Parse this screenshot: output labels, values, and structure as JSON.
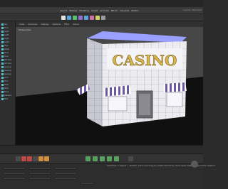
{
  "menubar": {
    "items": [
      "Layout",
      "Startup",
      "Modeling",
      "Sculpt",
      "Animate",
      "BP-UV",
      "Visualize",
      "Motion"
    ]
  },
  "header": {
    "right_info": "Layout: Standard"
  },
  "viewport": {
    "menus": [
      "View",
      "Cameras",
      "Display",
      "Options",
      "Filter",
      "Panel"
    ],
    "label": "Perspective",
    "sign_text": "CASINO"
  },
  "objects": {
    "items": [
      "Sky",
      "Floor",
      "Light",
      "Light",
      "Light",
      "Light",
      "Sign",
      "Walls",
      "Roof",
      "Door",
      "Window",
      "Window",
      "Awning",
      "Awning",
      "Awning",
      "Trim",
      "Trim",
      "Pillar",
      "Pillar",
      "Base",
      "Camera",
      "Null"
    ]
  },
  "status": {
    "text": "Selected: 1 object — Rotate: Click and drag to rotate elements. Hold down SHIFT to quantize rotation"
  },
  "icons": [
    "move-icon",
    "scale-icon",
    "rotate-icon",
    "render-icon",
    "cube-icon",
    "pen-icon",
    "light-icon",
    "camera-icon"
  ],
  "colors": {
    "accent": "#59c2d8",
    "sign": "#d8b64a",
    "awning": "#6b5aa0"
  }
}
